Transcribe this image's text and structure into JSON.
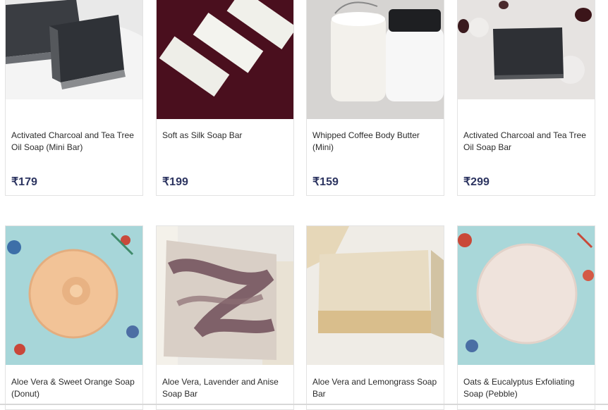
{
  "products": [
    {
      "title": "Activated Charcoal and Tea Tree Oil Soap (Mini Bar)",
      "price": "₹179"
    },
    {
      "title": "Soft as Silk Soap Bar",
      "price": "₹199"
    },
    {
      "title": "Whipped Coffee Body Butter (Mini)",
      "price": "₹159"
    },
    {
      "title": "Activated Charcoal and Tea Tree Oil Soap Bar",
      "price": "₹299"
    },
    {
      "title": "Aloe Vera & Sweet Orange Soap (Donut)"
    },
    {
      "title": "Aloe Vera, Lavender and Anise Soap Bar"
    },
    {
      "title": "Aloe Vera and Lemongrass Soap Bar"
    },
    {
      "title": "Oats & Eucalyptus Exfoliating Soap (Pebble)"
    }
  ]
}
